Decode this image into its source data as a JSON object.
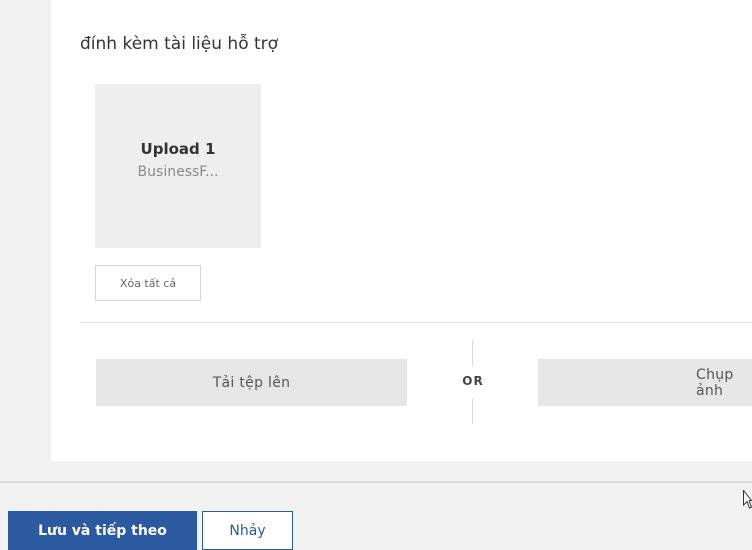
{
  "attachments": {
    "section_title": "đính kèm tài liệu hỗ trợ",
    "tile": {
      "title": "Upload 1",
      "filename": "BusinessF..."
    },
    "clear_all_label": "Xóa tất cả",
    "upload_label": "Tải tệp lên",
    "or_label": "OR",
    "camera_label": "Chụp ảnh"
  },
  "footer": {
    "save_next_label": "Lưu và tiếp theo",
    "skip_label": "Nhảy"
  },
  "colors": {
    "primary": "#2c5aa0",
    "tile_bg": "#eeeeee",
    "button_bg": "#e6e6e6",
    "page_bg": "#f2f2f2"
  }
}
